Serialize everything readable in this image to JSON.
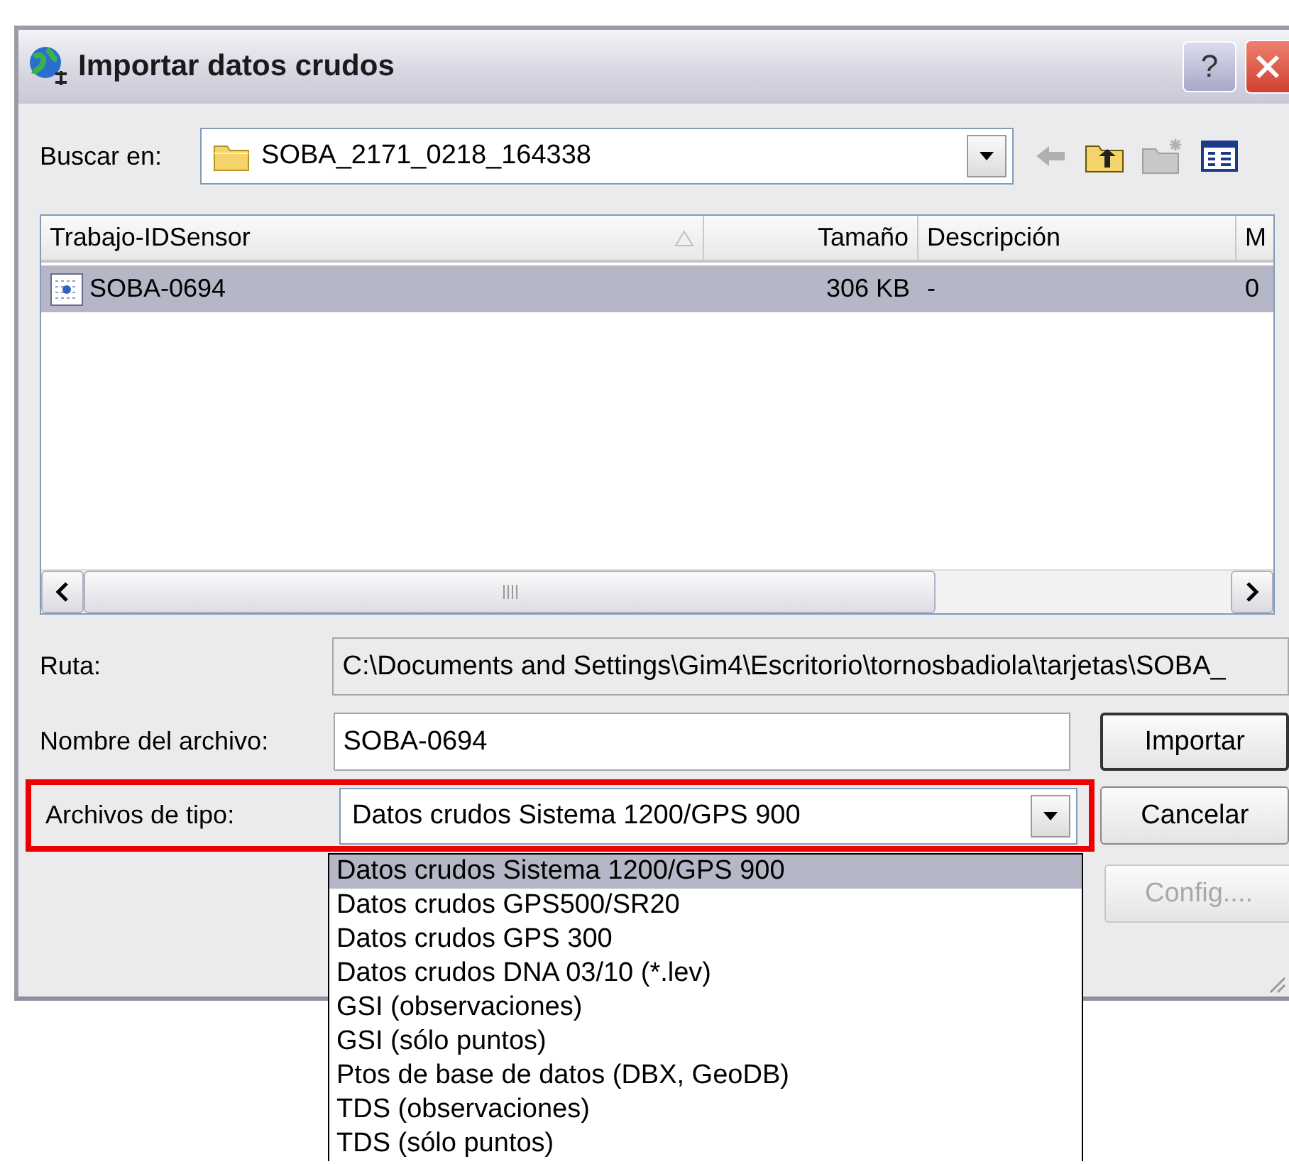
{
  "window": {
    "title": "Importar datos crudos",
    "help": "?"
  },
  "look_in": {
    "label": "Buscar en:",
    "value": "SOBA_2171_0218_164338"
  },
  "file_list": {
    "columns": [
      {
        "label": "Trabajo-IDSensor",
        "sorted": true
      },
      {
        "label": "Tamaño",
        "sorted": false
      },
      {
        "label": "Descripción",
        "sorted": false
      },
      {
        "label": "M",
        "sorted": false
      }
    ],
    "rows": [
      {
        "cells": [
          "SOBA-0694",
          "306 KB",
          "-",
          "0"
        ],
        "selected": true
      }
    ]
  },
  "path": {
    "label": "Ruta:",
    "value": "C:\\Documents and Settings\\Gim4\\Escritorio\\tornosbadiola\\tarjetas\\SOBA_"
  },
  "file_name": {
    "label": "Nombre del archivo:",
    "value": "SOBA-0694"
  },
  "file_type": {
    "label": "Archivos de tipo:",
    "value": "Datos crudos Sistema 1200/GPS 900",
    "highlighted": true,
    "options": [
      {
        "label": "Datos crudos Sistema 1200/GPS 900",
        "selected": true
      },
      {
        "label": "Datos crudos GPS500/SR20",
        "selected": false
      },
      {
        "label": "Datos crudos GPS 300",
        "selected": false
      },
      {
        "label": "Datos crudos DNA 03/10 (*.lev)",
        "selected": false
      },
      {
        "label": "GSI (observaciones)",
        "selected": false
      },
      {
        "label": "GSI (sólo puntos)",
        "selected": false
      },
      {
        "label": "Ptos de base de datos (DBX, GeoDB)",
        "selected": false
      },
      {
        "label": "TDS (observaciones)",
        "selected": false
      },
      {
        "label": "TDS (sólo puntos)",
        "selected": false
      }
    ]
  },
  "buttons": [
    {
      "label": "Importar",
      "disabled": false,
      "default": true
    },
    {
      "label": "Cancelar",
      "disabled": false,
      "default": false
    },
    {
      "label": "Config....",
      "disabled": true,
      "default": false
    }
  ]
}
